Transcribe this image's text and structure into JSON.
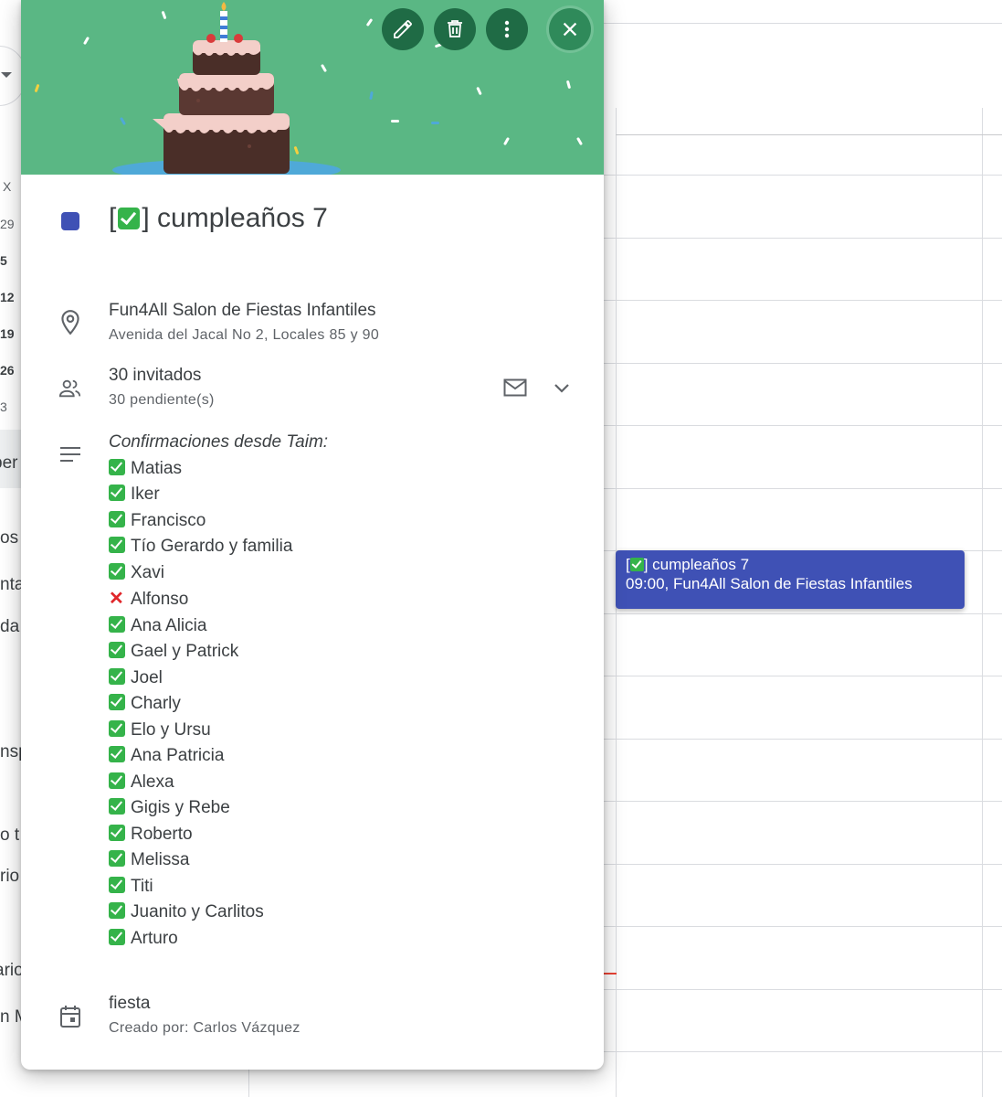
{
  "event": {
    "title_prefix": "[",
    "title_suffix": "] cumpleaños 7",
    "color": "#3f51b5",
    "location_name": "Fun4All Salon de Fiestas Infantiles",
    "location_address": "Avenida del Jacal No 2, Locales 85 y 90",
    "guests_count": "30 invitados",
    "guests_pending": "30 pendiente(s)",
    "description_heading": "Confirmaciones desde Taim:",
    "confirmations": [
      {
        "status": "yes",
        "name": "Matias"
      },
      {
        "status": "yes",
        "name": "Iker"
      },
      {
        "status": "yes",
        "name": "Francisco"
      },
      {
        "status": "yes",
        "name": "Tío Gerardo y familia"
      },
      {
        "status": "yes",
        "name": "Xavi"
      },
      {
        "status": "no",
        "name": "Alfonso"
      },
      {
        "status": "yes",
        "name": "Ana Alicia"
      },
      {
        "status": "yes",
        "name": "Gael y Patrick"
      },
      {
        "status": "yes",
        "name": "Joel"
      },
      {
        "status": "yes",
        "name": "Charly"
      },
      {
        "status": "yes",
        "name": "Elo y Ursu"
      },
      {
        "status": "yes",
        "name": "Ana Patricia"
      },
      {
        "status": "yes",
        "name": "Alexa"
      },
      {
        "status": "yes",
        "name": "Gigis y Rebe"
      },
      {
        "status": "yes",
        "name": "Roberto"
      },
      {
        "status": "yes",
        "name": "Melissa"
      },
      {
        "status": "yes",
        "name": "Titi"
      },
      {
        "status": "yes",
        "name": "Juanito y Carlitos"
      },
      {
        "status": "yes",
        "name": "Arturo"
      }
    ],
    "calendar_name": "fiesta",
    "created_by": "Creado por: Carlos Vázquez"
  },
  "chip": {
    "line1_prefix": "[",
    "line1_suffix": "] cumpleaños 7",
    "line2": "09:00, Fun4All Salon de Fiestas Infantiles"
  },
  "mini_calendar": {
    "weekday": "X",
    "days": [
      "29",
      "5",
      "12",
      "19",
      "26",
      "3"
    ]
  },
  "sidebar_fragments": [
    "ber",
    "os",
    "nta",
    "da",
    "nsp",
    "o t",
    "rio",
    "ario",
    "n M"
  ],
  "icons": {
    "toolbar": [
      "edit-pencil-icon",
      "delete-trash-icon",
      "more-options-icon",
      "close-icon"
    ],
    "rows": [
      "location-pin-icon",
      "guests-people-icon",
      "description-lines-icon",
      "calendar-icon"
    ],
    "actions": [
      "email-envelope-icon",
      "expand-chevron-icon"
    ]
  }
}
